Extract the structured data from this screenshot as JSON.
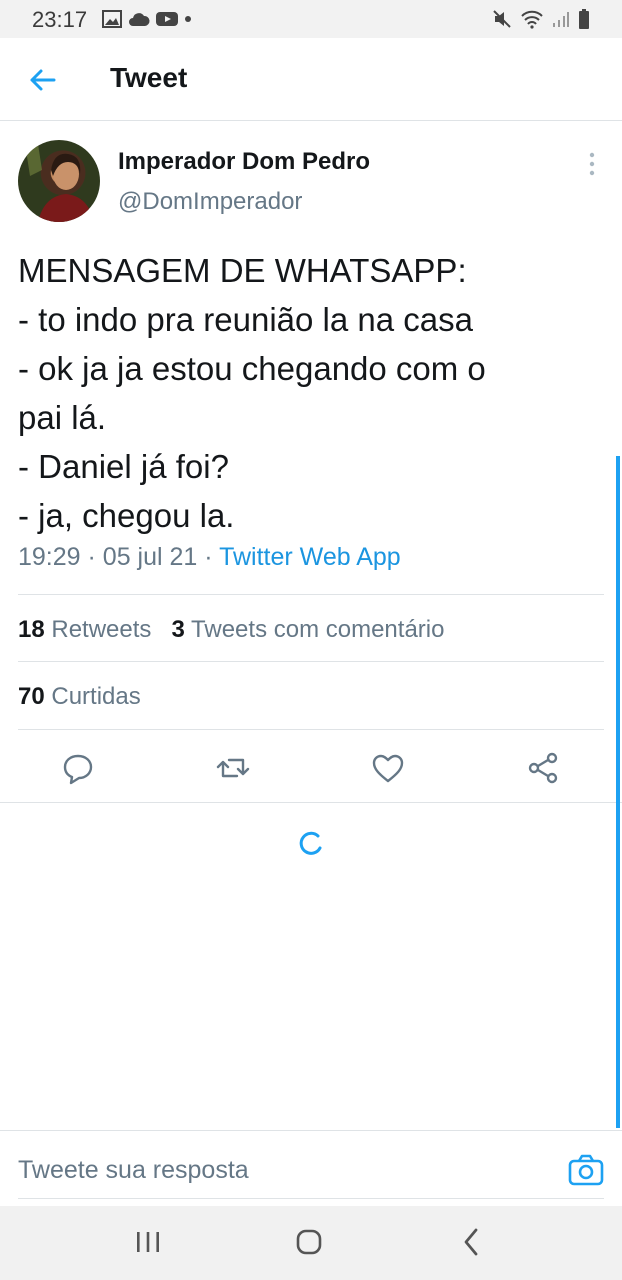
{
  "status_bar": {
    "time": "23:17",
    "left_icons": [
      "image-icon",
      "cloud-icon",
      "youtube-icon",
      "dot-icon"
    ],
    "right_icons": [
      "mute-icon",
      "wifi-icon",
      "signal-icon",
      "battery-icon"
    ]
  },
  "header": {
    "title": "Tweet"
  },
  "tweet": {
    "author_name": "Imperador Dom Pedro",
    "author_handle": "@DomImperador",
    "lines": [
      "MENSAGEM DE WHATSAPP:",
      "- to indo pra reunião la na casa",
      "- ok ja ja estou chegando com o",
      "pai lá.",
      "- Daniel já foi?",
      "- ja, chegou la."
    ],
    "time": "19:29",
    "date": "05 jul 21",
    "source": "Twitter Web App",
    "retweets_count": "18",
    "retweets_label": "Retweets",
    "quotes_count": "3",
    "quotes_label": "Tweets com comentário",
    "likes_count": "70",
    "likes_label": "Curtidas"
  },
  "reply": {
    "placeholder": "Tweete sua resposta"
  },
  "colors": {
    "accent": "#1da1f2",
    "text": "#14171a",
    "secondary": "#657786",
    "divider": "#dfe3e6"
  }
}
